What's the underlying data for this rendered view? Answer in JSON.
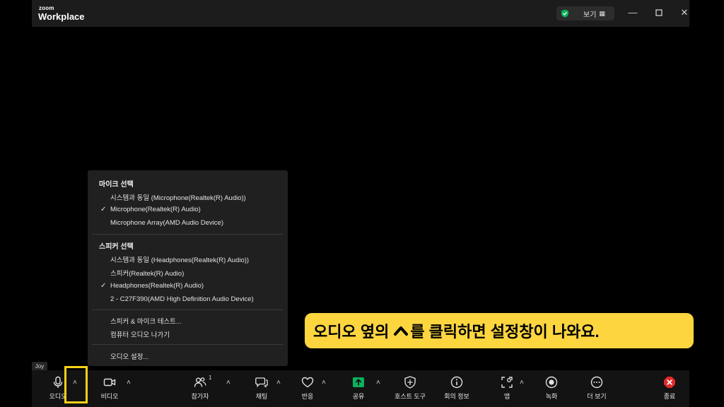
{
  "window": {
    "logo_small": "zoom",
    "logo_main": "Workplace",
    "view_label": "보기",
    "view_icon": "grid-icon",
    "controls": [
      "minimize-icon",
      "maximize-icon",
      "close-icon"
    ]
  },
  "menu": {
    "mic_header": "마이크 선택",
    "mic_items": [
      {
        "label": "시스템과 동일 (Microphone(Realtek(R) Audio))",
        "checked": false
      },
      {
        "label": "Microphone(Realtek(R) Audio)",
        "checked": true
      },
      {
        "label": "Microphone Array(AMD Audio Device)",
        "checked": false
      }
    ],
    "speaker_header": "스피커 선택",
    "speaker_items": [
      {
        "label": "시스템과 동일 (Headphones(Realtek(R) Audio))",
        "checked": false
      },
      {
        "label": "스피커(Realtek(R) Audio)",
        "checked": false
      },
      {
        "label": "Headphones(Realtek(R) Audio)",
        "checked": true
      },
      {
        "label": "2 - C27F390(AMD High Definition Audio Device)",
        "checked": false
      }
    ],
    "test_label": "스피커 & 마이크 테스트...",
    "leave_audio_label": "컴퓨터 오디오 나가기",
    "settings_label": "오디오 설정...",
    "check_mark": "✓"
  },
  "callout": {
    "text_before": "오디오 옆의 ",
    "text_after": "를 클릭하면 설정창이 나와요."
  },
  "participant_name": "Joy",
  "toolbar": {
    "audio": "오디오",
    "video": "비디오",
    "participants": "참가자",
    "participants_count": "1",
    "chat": "채팅",
    "reactions": "반응",
    "share": "공유",
    "host_tools": "호스트 도구",
    "meeting_info": "회의 정보",
    "apps": "앱",
    "record": "녹화",
    "more": "더 보기",
    "end": "종료",
    "caret": "˄"
  },
  "colors": {
    "accent_green": "#0bb15b",
    "callout_bg": "#fcd53f",
    "highlight_border": "#f7d117",
    "end_red": "#e02a2a"
  }
}
